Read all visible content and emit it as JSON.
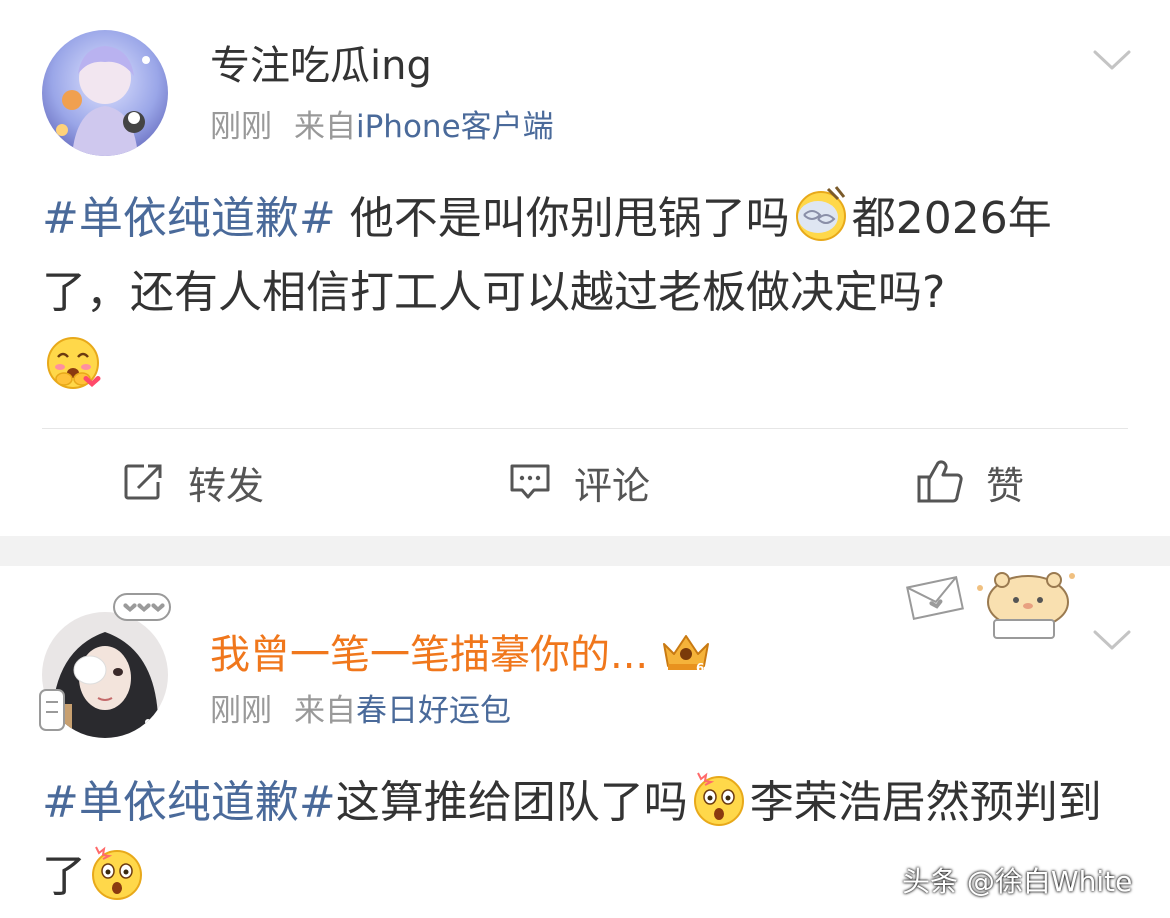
{
  "posts": [
    {
      "username": "专注吃瓜ing",
      "time": "刚刚",
      "source_prefix": "来自",
      "source": "iPhone客户端",
      "content": {
        "topic": "#单依纯道歉#",
        "text_1": " 他不是叫你别甩锅了吗",
        "emoji_1": "dizzy-face-emoji",
        "text_2": "都2026年了，还有人相信打工人可以越过老板做决定吗?",
        "emoji_2": "touched-blushing-emoji"
      }
    },
    {
      "username": "我曾一笔一笔描摹你的...",
      "badge": "crown-vip-badge",
      "time": "刚刚",
      "source_prefix": "来自",
      "source": "春日好运包",
      "content": {
        "topic": "#单依纯道歉#",
        "text_1": "这算推给团队了吗",
        "emoji_1": "shocked-face-emoji",
        "text_2": "李荣浩居然预判到了",
        "emoji_2": "shocked-face-emoji"
      }
    }
  ],
  "actions": {
    "repost": "转发",
    "comment": "评论",
    "like": "赞"
  },
  "watermark": "头条 @徐白White",
  "colors": {
    "topic": "#4a6a9a",
    "vip_name": "#f0771c",
    "meta": "#999999",
    "separator": "#f2f2f2"
  }
}
